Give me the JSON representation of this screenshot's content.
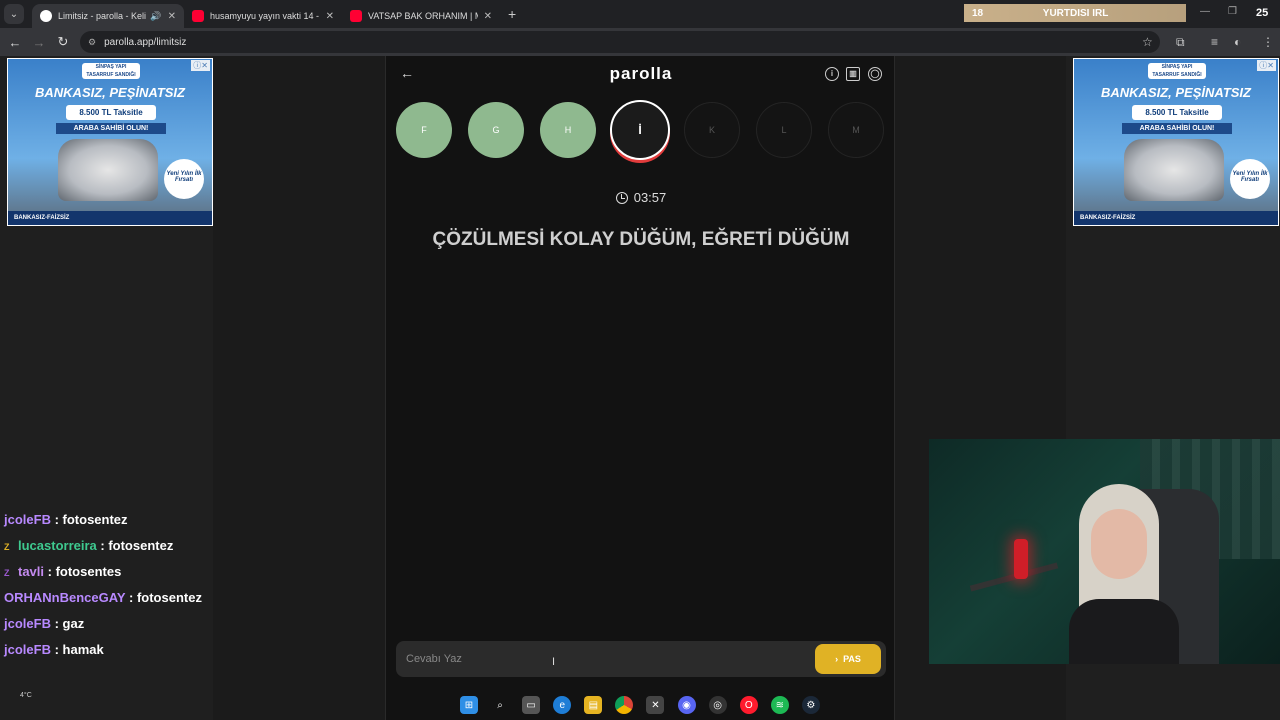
{
  "browser": {
    "tabs": [
      {
        "title": "Limitsiz - parolla - Kelime o",
        "active": true,
        "muted_icon": "speaker-icon"
      },
      {
        "title": "husamyuyu yayın vakti 14 - You",
        "active": false
      },
      {
        "title": "VATSAP BAK ORHANIM | Mada",
        "active": false
      }
    ],
    "url": "parolla.app/limitsiz",
    "overlay": {
      "left": "18",
      "center": "YURTDISI IRL",
      "right": "25"
    }
  },
  "ads": {
    "brand": "SİNPAŞ YAPI TASARRUF SANDIĞI",
    "headline": "BANKASIZ, PEŞİNATSIZ",
    "price": "8.500 TL Taksitle",
    "cta": "ARABA SAHİBİ OLUN!",
    "badge": "Yeni Yılın İlk Fırsatı",
    "footer": "BANKASIZ-FAİZSİZ"
  },
  "game": {
    "logo": "parolla",
    "letters": [
      {
        "letter": "F",
        "state": "done"
      },
      {
        "letter": "G",
        "state": "done"
      },
      {
        "letter": "H",
        "state": "done"
      },
      {
        "letter": "İ",
        "state": "current"
      },
      {
        "letter": "K",
        "state": "pending"
      },
      {
        "letter": "L",
        "state": "pending"
      },
      {
        "letter": "M",
        "state": "pending"
      }
    ],
    "timer": "03:57",
    "question": "ÇÖZÜLMESİ KOLAY DÜĞÜM, EĞRETİ DÜĞÜM",
    "answer_placeholder": "Cevabı Yaz",
    "pass_label": "PAS",
    "colors": {
      "done": "#8fb98f",
      "current_ring": "#e23c3c",
      "pass": "#e0b225"
    }
  },
  "chat": [
    {
      "user": "jcoleFB",
      "color": "#b889ff",
      "message": "fotosentez",
      "badge": ""
    },
    {
      "user": "lucastorreira",
      "color": "#3ec98f",
      "message": "fotosentez",
      "badge": "Z"
    },
    {
      "user": "tavli",
      "color": "#c48bf0",
      "message": "fotosentes",
      "badge": "Z"
    },
    {
      "user": "ORHANnBenceGAY",
      "color": "#b889ff",
      "message": "fotosentez",
      "badge": ""
    },
    {
      "user": "jcoleFB",
      "color": "#b889ff",
      "message": "gaz",
      "badge": ""
    },
    {
      "user": "jcoleFB",
      "color": "#b889ff",
      "message": "hamak",
      "badge": ""
    }
  ],
  "weather": "4°C"
}
